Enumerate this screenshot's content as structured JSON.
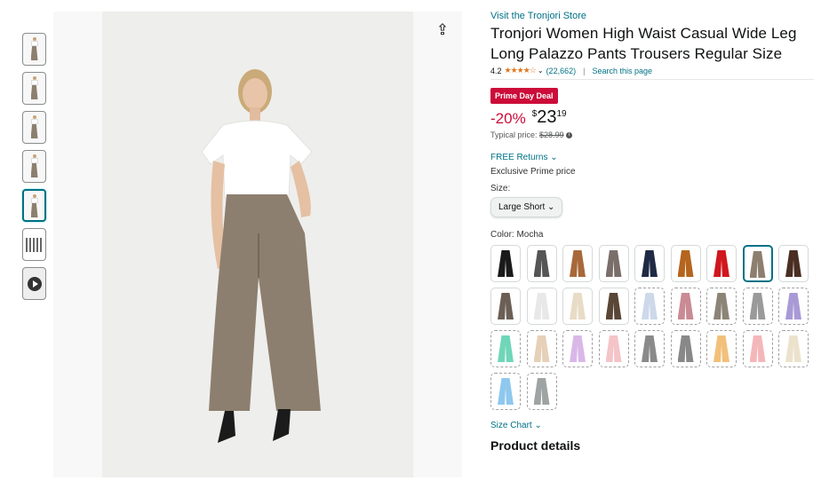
{
  "thumbnails": [
    {
      "kind": "photo",
      "color": "#8d7f6f"
    },
    {
      "kind": "photo",
      "color": "#8d7f6f"
    },
    {
      "kind": "photo",
      "color": "#8d7f6f"
    },
    {
      "kind": "photo",
      "color": "#8d7f6f"
    },
    {
      "kind": "photo",
      "color": "#8d7f6f",
      "selected": true
    },
    {
      "kind": "size-chart"
    },
    {
      "kind": "video"
    }
  ],
  "share_icon": "share-icon",
  "store_link": "Visit the Tronjori Store",
  "title": "Tronjori Women High Waist Casual Wide Leg Long Palazzo Pants Trousers Regular Size",
  "rating": {
    "value": "4.2",
    "stars": "★★★★☆",
    "count": "(22,662)",
    "search_link": "Search this page"
  },
  "deal_badge": "Prime Day Deal",
  "price": {
    "discount": "-20%",
    "currency": "$",
    "whole": "23",
    "fraction": "19"
  },
  "typical_price": {
    "label": "Typical price:",
    "value": "$28.99"
  },
  "returns": "FREE Returns",
  "exclusive": "Exclusive Prime price",
  "size": {
    "label": "Size:",
    "selected": "Large Short"
  },
  "color": {
    "label": "Color: ",
    "selected": "Mocha"
  },
  "swatches": [
    {
      "color": "#1a1a1a"
    },
    {
      "color": "#555555"
    },
    {
      "color": "#a8683a"
    },
    {
      "color": "#7a6e6a"
    },
    {
      "color": "#1f2a44"
    },
    {
      "color": "#b5651d"
    },
    {
      "color": "#d0161e"
    },
    {
      "color": "#8d7f6f",
      "selected": true
    },
    {
      "color": "#4a2e22"
    },
    {
      "color": "#6b5f56"
    },
    {
      "color": "#e8e8e8"
    },
    {
      "color": "#e8dcc6"
    },
    {
      "color": "#5a4636"
    },
    {
      "color": "#cdd9ea",
      "dashed": true
    },
    {
      "color": "#c98a94",
      "dashed": true
    },
    {
      "color": "#8c8476",
      "dashed": true
    },
    {
      "color": "#9a9a9a",
      "dashed": true
    },
    {
      "color": "#a99ad6",
      "dashed": true
    },
    {
      "color": "#6fd6b8",
      "dashed": true
    },
    {
      "color": "#e6d0b8",
      "dashed": true
    },
    {
      "color": "#d9b8e8",
      "dashed": true
    },
    {
      "color": "#f4c4c8",
      "dashed": true
    },
    {
      "color": "#8a8a8a",
      "dashed": true
    },
    {
      "color": "#888888",
      "dashed": true
    },
    {
      "color": "#f2c07a",
      "dashed": true
    },
    {
      "color": "#f4b7b9",
      "dashed": true
    },
    {
      "color": "#ece2cc",
      "dashed": true
    },
    {
      "color": "#8ec8ee",
      "dashed": true
    },
    {
      "color": "#9ea3a3",
      "dashed": true
    }
  ],
  "size_chart": "Size Chart",
  "product_details": "Product details"
}
